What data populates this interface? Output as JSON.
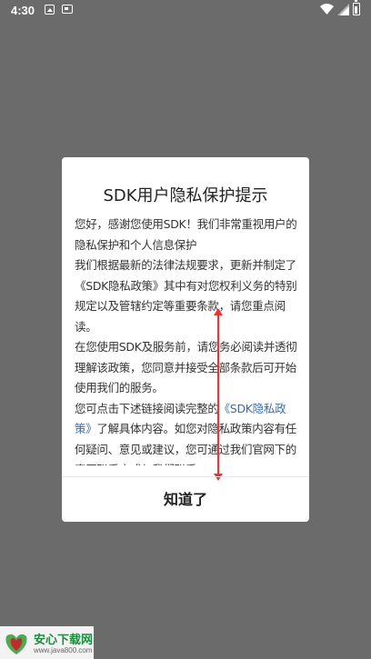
{
  "status_bar": {
    "time": "4:30"
  },
  "dialog": {
    "title": "SDK用户隐私保护提示",
    "paragraphs": {
      "p1": "您好，感谢您使用SDK！我们非常重视用户的隐私保护和个人信息保护",
      "p2": "我们根据最新的法律法规要求，更新并制定了《SDK隐私政策》其中有对您权利义务的特别规定以及管辖约定等重要条款，请您重点阅读。",
      "p3": "在您使用SDK及服务前，请您务必阅读并透彻理解该政策，您同意并接受全部条款后可开始使用我们的服务。",
      "p4_before": "您可点击下述链接阅读完整的",
      "p4_link": "《SDK隐私政策》",
      "p4_after": "了解具体内容。如您对隐私政策内容有任何疑问、意见或建议，您可通过我们官网下的官网联系方式与我们联系。"
    },
    "confirm_label": "知道了"
  },
  "watermark": {
    "name": "安心下载网",
    "url": "www.java800.com"
  },
  "colors": {
    "overlay": "#6b6b6b",
    "link": "#3b6ea8",
    "annotation_arrow": "#e33333",
    "watermark_brand": "#1b8e3e"
  }
}
